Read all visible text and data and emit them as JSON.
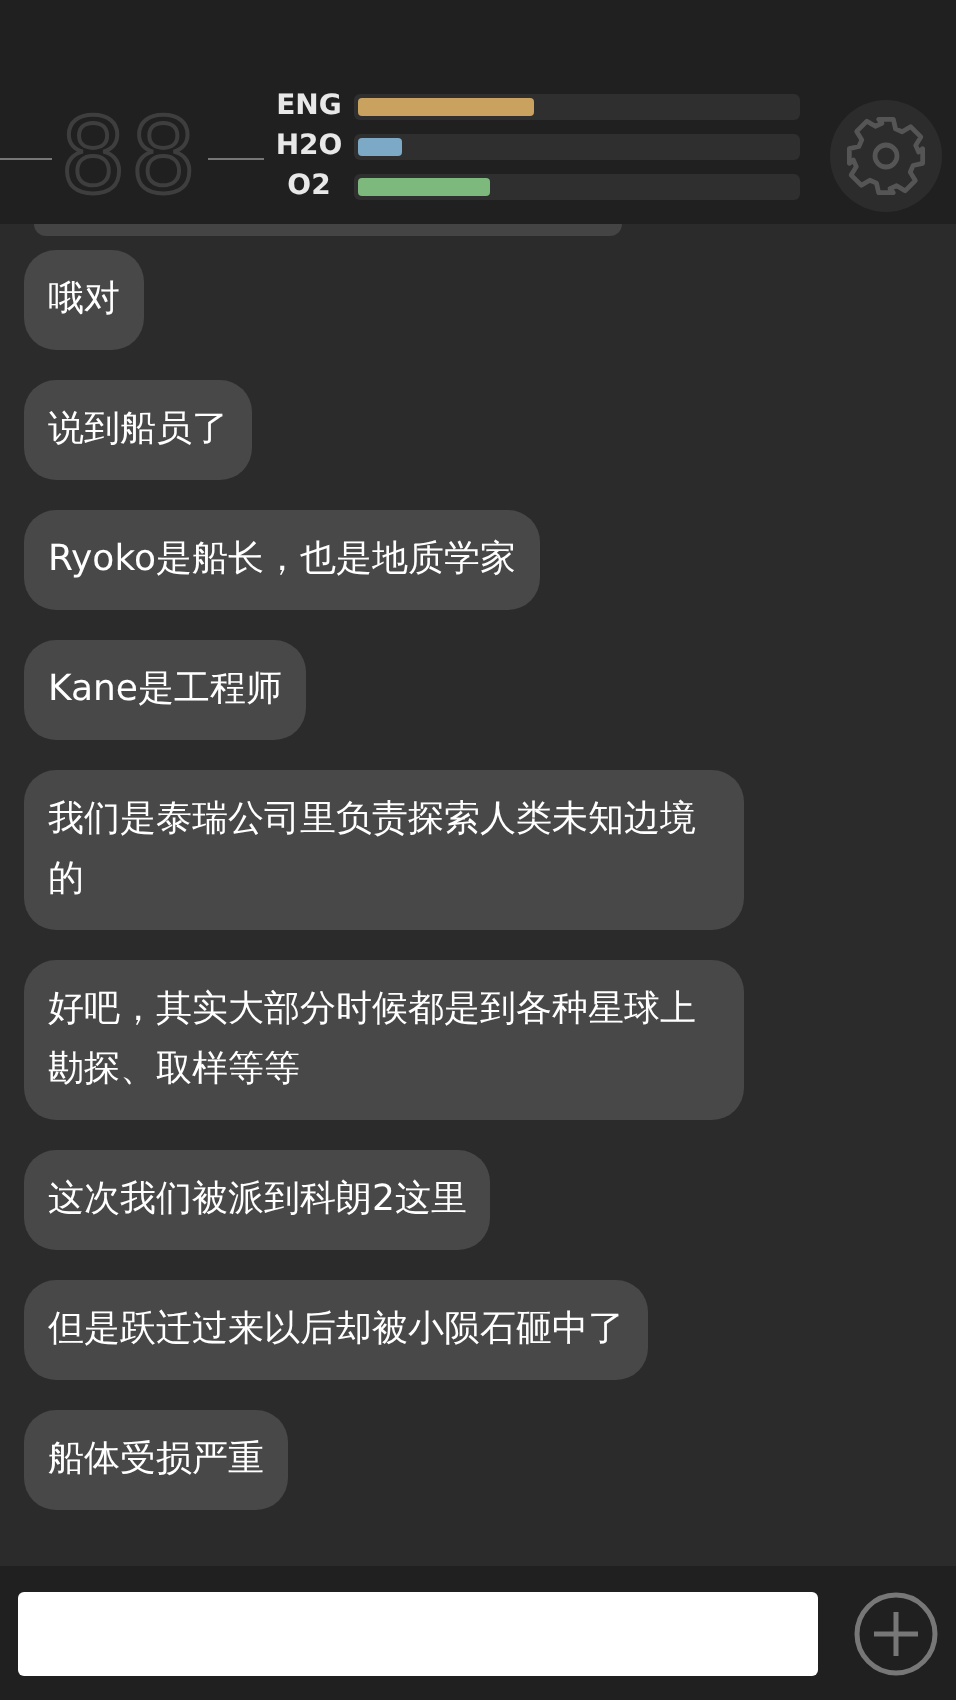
{
  "header": {
    "counter": "88",
    "gauges": [
      {
        "label": "ENG",
        "level": 0.4,
        "color": "#c8a25e"
      },
      {
        "label": "H2O",
        "level": 0.1,
        "color": "#7ba9c6"
      },
      {
        "label": "O2",
        "level": 0.3,
        "color": "#7db87d"
      }
    ]
  },
  "messages": [
    {
      "text": "哦对"
    },
    {
      "text": "说到船员了"
    },
    {
      "text": "Ryoko是船长，也是地质学家"
    },
    {
      "text": "Kane是工程师"
    },
    {
      "text": "我们是泰瑞公司里负责探索人类未知边境的"
    },
    {
      "text": "好吧，其实大部分时候都是到各种星球上勘探、取样等等"
    },
    {
      "text": "这次我们被派到科朗2这里"
    },
    {
      "text": "但是跃迁过来以后却被小陨石砸中了"
    },
    {
      "text": "船体受损严重"
    }
  ]
}
